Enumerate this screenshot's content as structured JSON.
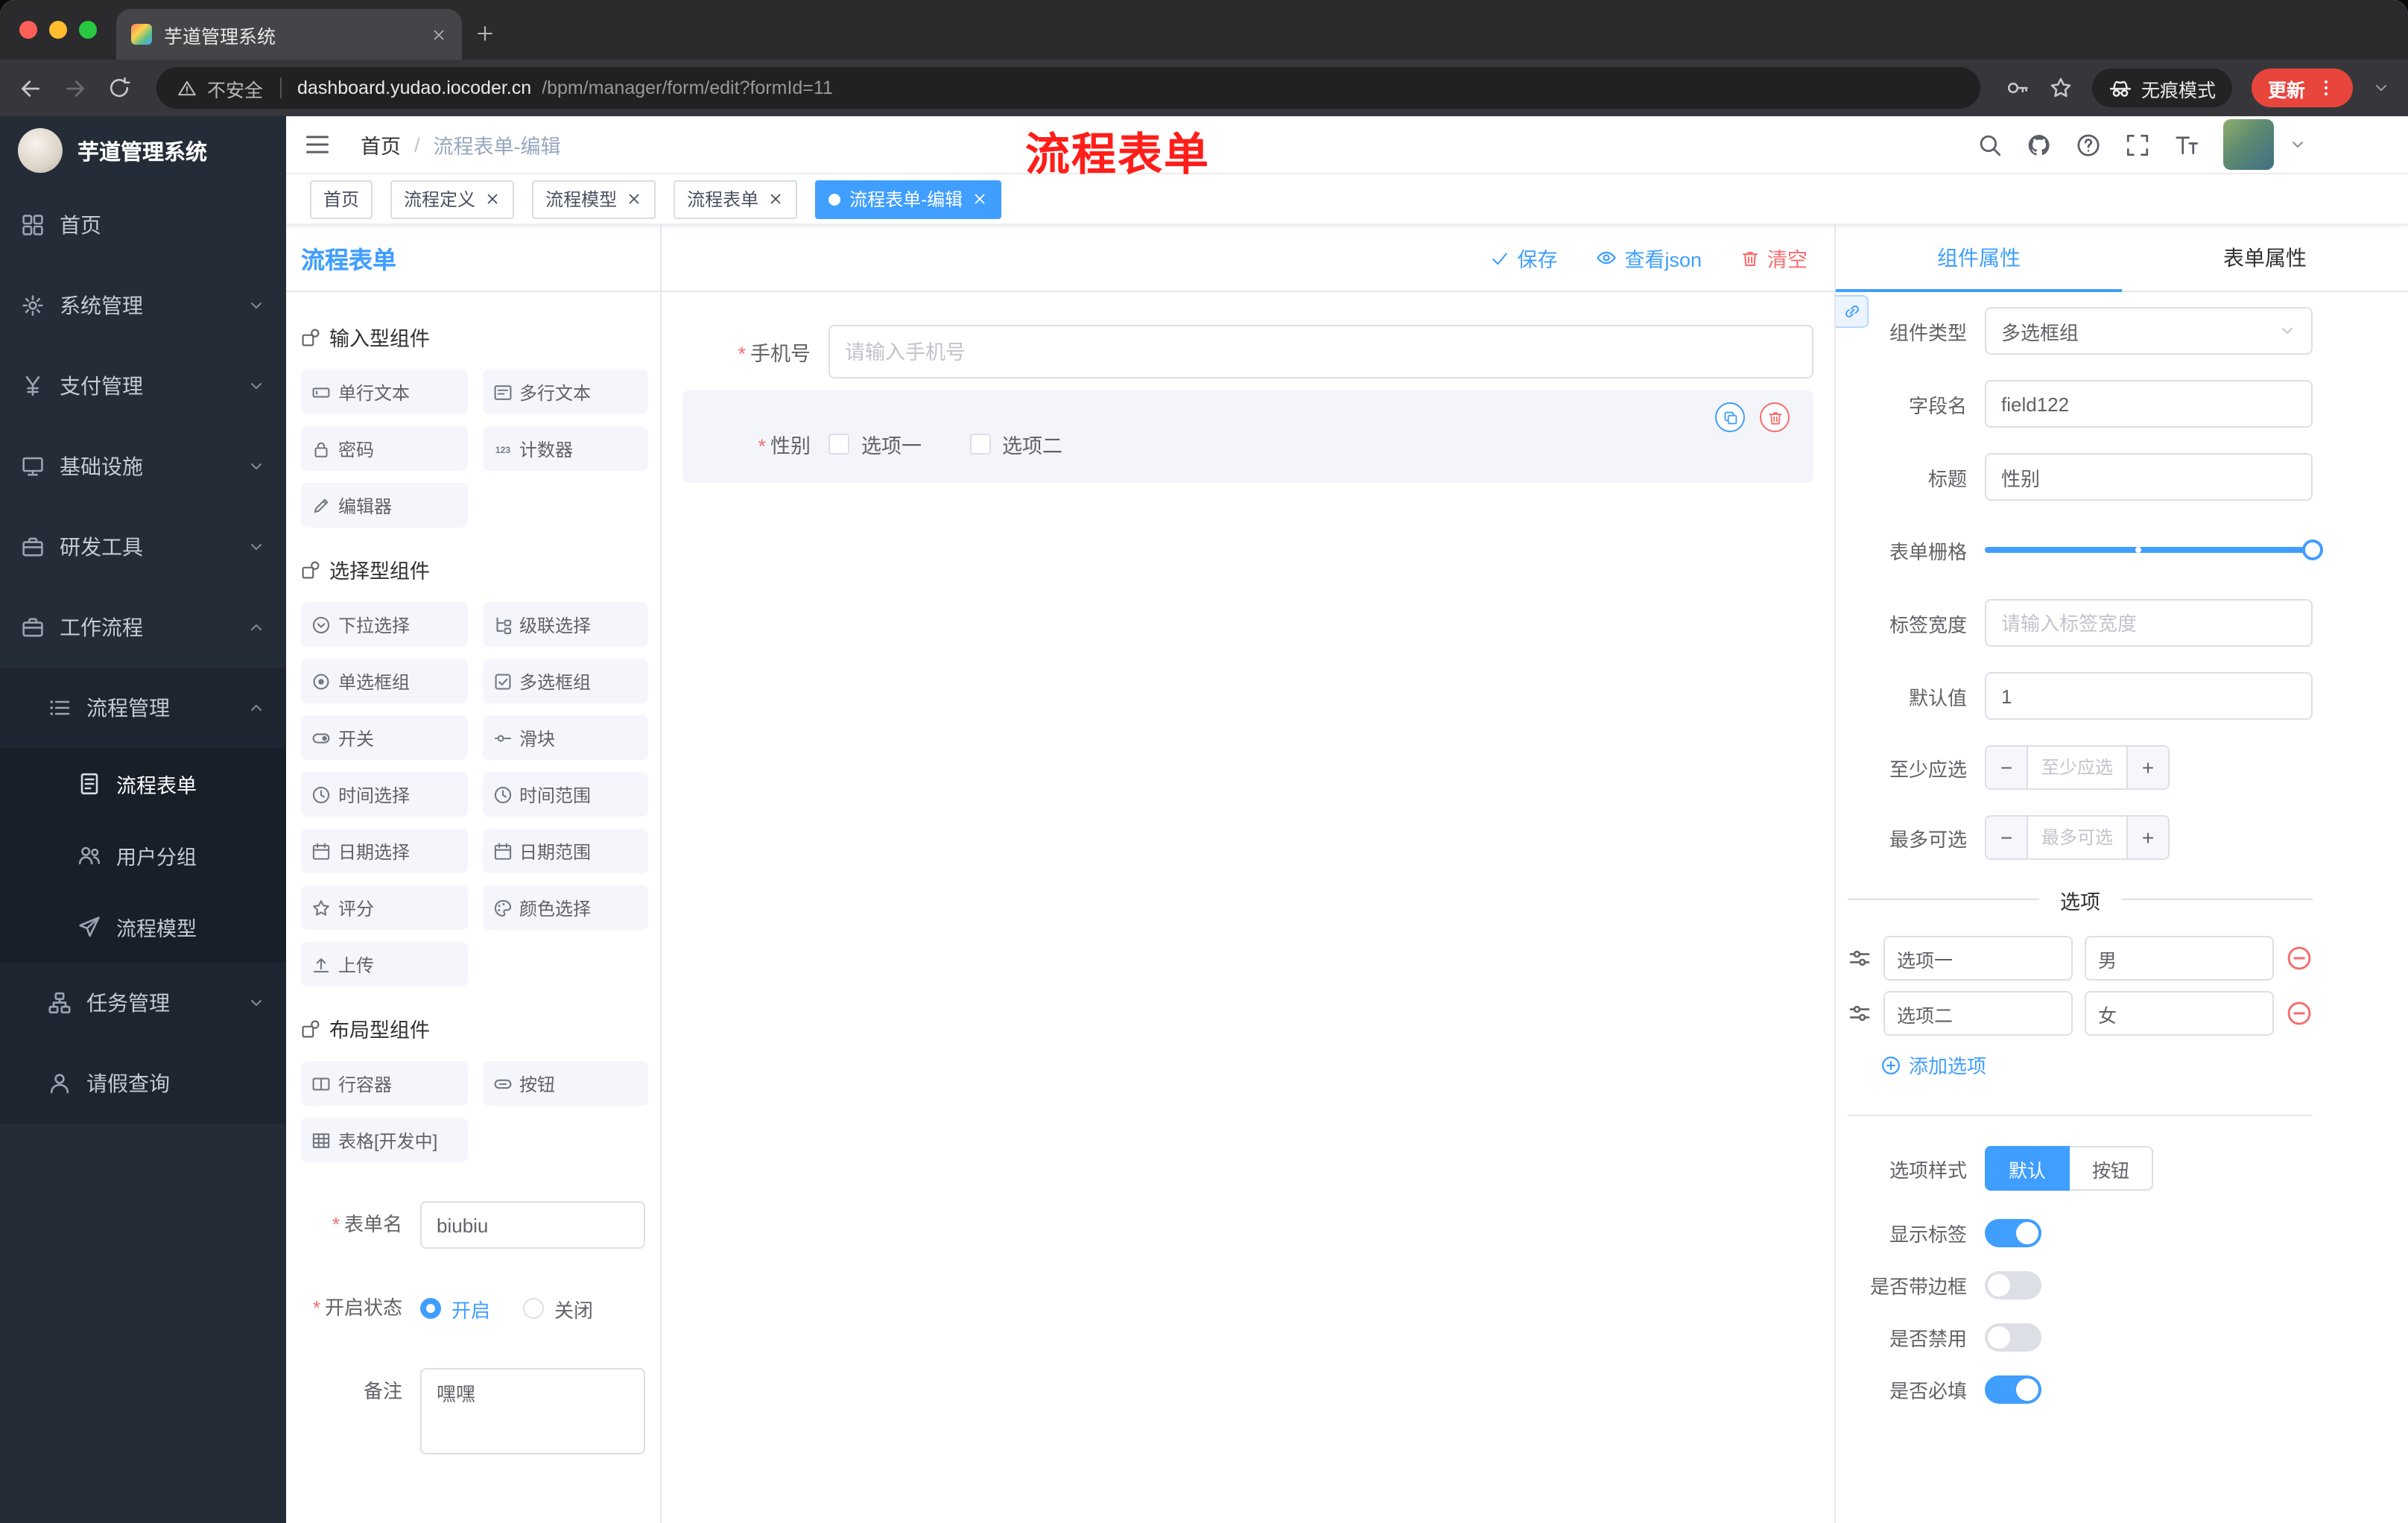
{
  "browser": {
    "tab_title": "芋道管理系统",
    "security_label": "不安全",
    "url_host": "dashboard.yudao.iocoder.cn",
    "url_path": "/bpm/manager/form/edit?formId=11",
    "incognito_label": "无痕模式",
    "update_label": "更新"
  },
  "annotation_title": "流程表单",
  "sidebar": {
    "logo_title": "芋道管理系统",
    "items": [
      {
        "label": "首页"
      },
      {
        "label": "系统管理"
      },
      {
        "label": "支付管理"
      },
      {
        "label": "基础设施"
      },
      {
        "label": "研发工具"
      },
      {
        "label": "工作流程"
      },
      {
        "label": "流程管理"
      },
      {
        "label": "流程表单"
      },
      {
        "label": "用户分组"
      },
      {
        "label": "流程模型"
      },
      {
        "label": "任务管理"
      },
      {
        "label": "请假查询"
      }
    ]
  },
  "header": {
    "breadcrumb_home": "首页",
    "breadcrumb_current": "流程表单-编辑"
  },
  "tags": [
    {
      "label": "首页"
    },
    {
      "label": "流程定义"
    },
    {
      "label": "流程模型"
    },
    {
      "label": "流程表单"
    },
    {
      "label": "流程表单-编辑"
    }
  ],
  "designer": {
    "panel_title": "流程表单",
    "toolbar": {
      "save": "保存",
      "view_json": "查看json",
      "clear": "清空"
    },
    "palette": {
      "section_input": "输入型组件",
      "section_select": "选择型组件",
      "section_layout": "布局型组件",
      "input_items": [
        "单行文本",
        "多行文本",
        "密码",
        "计数器",
        "编辑器"
      ],
      "select_items": [
        "下拉选择",
        "级联选择",
        "单选框组",
        "多选框组",
        "开关",
        "滑块",
        "时间选择",
        "时间范围",
        "日期选择",
        "日期范围",
        "评分",
        "颜色选择",
        "上传"
      ],
      "layout_items": [
        "行容器",
        "按钮",
        "表格[开发中]"
      ]
    },
    "meta": {
      "name_label": "表单名",
      "name_value": "biubiu",
      "status_label": "开启状态",
      "status_on": "开启",
      "status_off": "关闭",
      "status_value": "开启",
      "remark_label": "备注",
      "remark_value": "嘿嘿"
    },
    "canvas": {
      "phone_label": "手机号",
      "phone_placeholder": "请输入手机号",
      "gender_label": "性别",
      "gender_option1": "选项一",
      "gender_option2": "选项二"
    }
  },
  "props": {
    "tab_component": "组件属性",
    "tab_form": "表单属性",
    "component_type_label": "组件类型",
    "component_type_value": "多选框组",
    "field_name_label": "字段名",
    "field_name_value": "field122",
    "title_label": "标题",
    "title_value": "性别",
    "grid_label": "表单栅格",
    "label_width_label": "标签宽度",
    "label_width_placeholder": "请输入标签宽度",
    "default_label": "默认值",
    "default_value": "1",
    "min_label": "至少应选",
    "min_placeholder": "至少应选",
    "max_label": "最多可选",
    "max_placeholder": "最多可选",
    "options_title": "选项",
    "options": [
      {
        "label": "选项一",
        "value": "男"
      },
      {
        "label": "选项二",
        "value": "女"
      }
    ],
    "add_option": "添加选项",
    "style_label": "选项样式",
    "style_default": "默认",
    "style_button": "按钮",
    "toggle_show_label": "显示标签",
    "toggle_show_value": true,
    "toggle_border_label": "是否带边框",
    "toggle_border_value": false,
    "toggle_disabled_label": "是否禁用",
    "toggle_disabled_value": false,
    "toggle_required_label": "是否必填",
    "toggle_required_value": true
  },
  "colors": {
    "primary": "#409eff",
    "danger": "#f56c6c",
    "annotation_red": "#fe1f1a",
    "update_button": "#e8453c",
    "sidebar_bg": "#242c38"
  },
  "icons": {
    "favicon": "colorful-feather",
    "search": "magnifier",
    "github": "octocat-mark",
    "help": "question-circle",
    "fullscreen": "expand-corners",
    "font_size": "text-size",
    "incognito": "spy-glasses",
    "save": "check",
    "view_json": "eye",
    "clear": "trash"
  }
}
